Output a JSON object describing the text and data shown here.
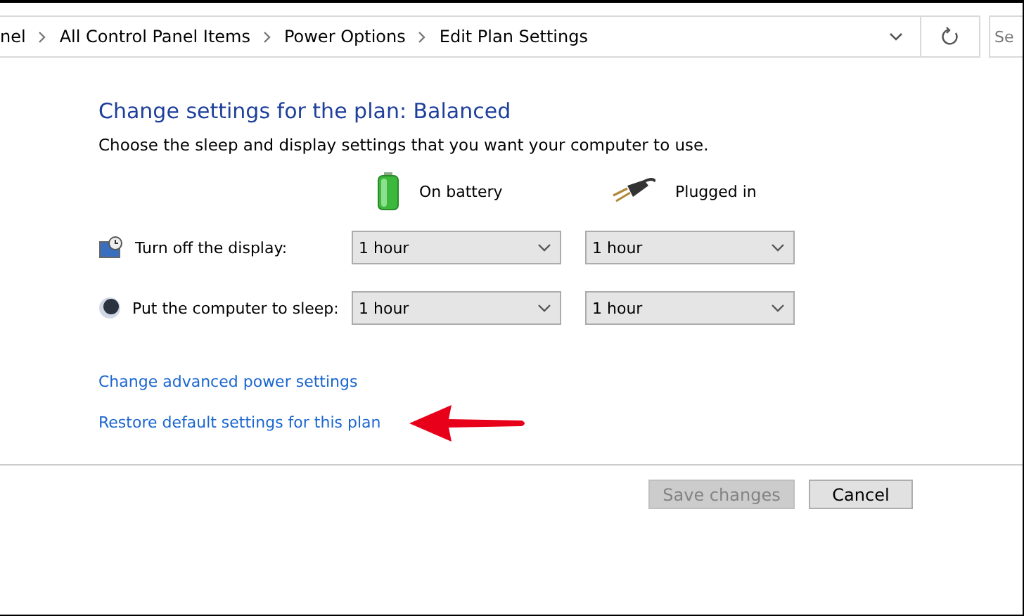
{
  "address_bar": {
    "breadcrumbs": [
      "nel",
      "All Control Panel Items",
      "Power Options",
      "Edit Plan Settings"
    ],
    "search_placeholder": "Se"
  },
  "heading": "Change settings for the plan: Balanced",
  "description": "Choose the sleep and display settings that you want your computer to use.",
  "columns": [
    {
      "kind": "battery",
      "label": "On battery"
    },
    {
      "kind": "plug",
      "label": "Plugged in"
    }
  ],
  "settings": [
    {
      "kind": "display",
      "label": "Turn off the display:",
      "values": [
        "1 hour",
        "1 hour"
      ]
    },
    {
      "kind": "sleep",
      "label": "Put the computer to sleep:",
      "values": [
        "1 hour",
        "1 hour"
      ]
    }
  ],
  "links": [
    "Change advanced power settings",
    "Restore default settings for this plan"
  ],
  "buttons": [
    {
      "label": "Save changes",
      "disabled": true
    },
    {
      "label": "Cancel",
      "disabled": false
    }
  ]
}
